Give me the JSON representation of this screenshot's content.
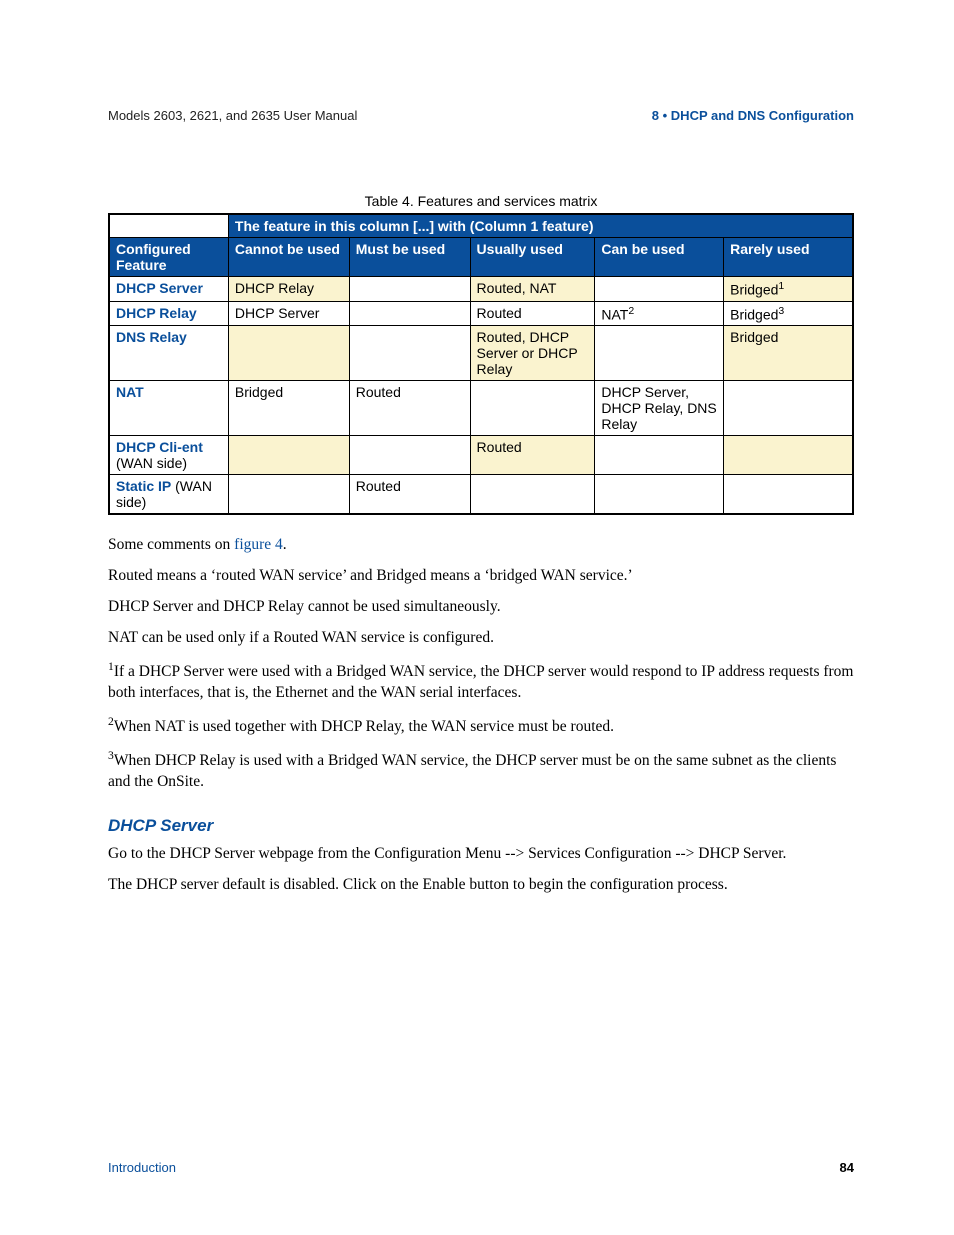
{
  "header": {
    "left": "Models 2603, 2621, and 2635 User Manual",
    "right": "8 • DHCP and DNS Configuration"
  },
  "table": {
    "caption": "Table 4. Features and services matrix",
    "spanHeader": "The feature in this column [...] with (Column 1 feature)",
    "colHeaders": {
      "c0": "Configured Feature",
      "c1": "Cannot be used",
      "c2": "Must be used",
      "c3": "Usually used",
      "c4": "Can be used",
      "c5": "Rarely used"
    },
    "rows": [
      {
        "label": "DHCP Server",
        "labelSub": "",
        "cream": true,
        "c1": "DHCP Relay",
        "c2": "",
        "c3": "Routed, NAT",
        "c4": "",
        "c5": "Bridged",
        "c5sup": "1"
      },
      {
        "label": "DHCP Relay",
        "labelSub": "",
        "cream": false,
        "c1": "DHCP Server",
        "c2": "",
        "c3": "Routed",
        "c4": "NAT",
        "c4sup": "2",
        "c5": "Bridged",
        "c5sup": "3"
      },
      {
        "label": "DNS Relay",
        "labelSub": "",
        "cream": true,
        "c1": "",
        "c2": "",
        "c3": "Routed, DHCP Server or DHCP Relay",
        "c4": "",
        "c5": "Bridged"
      },
      {
        "label": "NAT",
        "labelSub": "",
        "cream": false,
        "c1": "Bridged",
        "c2": "Routed",
        "c3": "",
        "c4": "DHCP Server, DHCP Relay, DNS Relay",
        "c5": ""
      },
      {
        "label": "DHCP Cli-ent",
        "labelSub": " (WAN side)",
        "cream": true,
        "c1": "",
        "c2": "",
        "c3": "Routed",
        "c4": "",
        "c5": ""
      },
      {
        "label": "Static IP",
        "labelSub": " (WAN side)",
        "cream": false,
        "c1": "",
        "c2": "Routed",
        "c3": "",
        "c4": "",
        "c5": ""
      }
    ]
  },
  "comments": {
    "intro_pre": "Some comments on ",
    "intro_link": "figure 4",
    "intro_post": ".",
    "p1": "Routed means a ‘routed WAN service’ and Bridged means a ‘bridged WAN service.’",
    "p2": "DHCP Server and DHCP Relay cannot be used simultaneously.",
    "p3": "NAT can be used only if a Routed WAN service is configured.",
    "n1_sup": "1",
    "n1": "If a DHCP Server were used with a Bridged WAN service, the DHCP server would respond to IP address requests from both interfaces, that is, the Ethernet and the WAN serial interfaces.",
    "n2_sup": "2",
    "n2": "When NAT is used together with DHCP Relay, the WAN service must be routed.",
    "n3_sup": "3",
    "n3": "When DHCP Relay is used with a Bridged WAN service, the DHCP server must be on the same subnet as the clients and the OnSite."
  },
  "section": {
    "title": "DHCP Server",
    "p1": "Go to the DHCP Server webpage from the Configuration Menu --> Services Configuration --> DHCP Server.",
    "p2": "The DHCP server default is disabled. Click on the Enable button to begin the configuration process."
  },
  "footer": {
    "left": "Introduction",
    "right": "84"
  }
}
